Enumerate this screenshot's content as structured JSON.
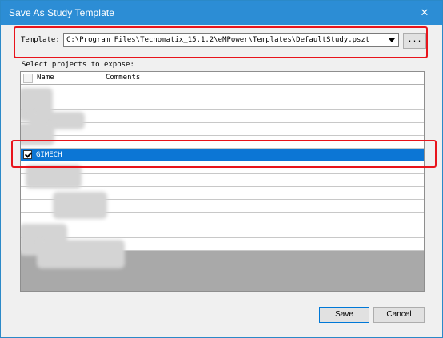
{
  "window": {
    "title": "Save As Study Template",
    "close_label": "✕"
  },
  "template": {
    "label": "Template:",
    "value": "C:\\Program Files\\Tecnomatix_15.1.2\\eMPower\\Templates\\DefaultStudy.pszt",
    "browse_label": "..."
  },
  "projects": {
    "label": "Select projects to expose:",
    "columns": {
      "name": "Name",
      "comments": "Comments"
    },
    "rows": [
      {
        "name": "",
        "comments": "",
        "checked": false,
        "selected": false
      },
      {
        "name": "",
        "comments": "",
        "checked": false,
        "selected": false
      },
      {
        "name": "",
        "comments": "",
        "checked": false,
        "selected": false
      },
      {
        "name": "",
        "comments": "",
        "checked": false,
        "selected": false
      },
      {
        "name": "",
        "comments": "",
        "checked": false,
        "selected": false
      },
      {
        "name": "GIMECH",
        "comments": "",
        "checked": true,
        "selected": true
      },
      {
        "name": "",
        "comments": "",
        "checked": false,
        "selected": false
      },
      {
        "name": "",
        "comments": "",
        "checked": false,
        "selected": false
      },
      {
        "name": "",
        "comments": "",
        "checked": false,
        "selected": false
      },
      {
        "name": "",
        "comments": "",
        "checked": false,
        "selected": false
      },
      {
        "name": "",
        "comments": "",
        "checked": false,
        "selected": false
      },
      {
        "name": "",
        "comments": "",
        "checked": false,
        "selected": false
      },
      {
        "name": "",
        "comments": "",
        "checked": false,
        "selected": false
      }
    ]
  },
  "buttons": {
    "save": "Save",
    "cancel": "Cancel"
  },
  "colors": {
    "titlebar": "#2c8dd5",
    "selection": "#0c76d5",
    "highlight": "#e8141c"
  },
  "icons": {
    "close": "close-icon",
    "dropdown": "chevron-down-icon",
    "check": "checkbox-icon"
  }
}
